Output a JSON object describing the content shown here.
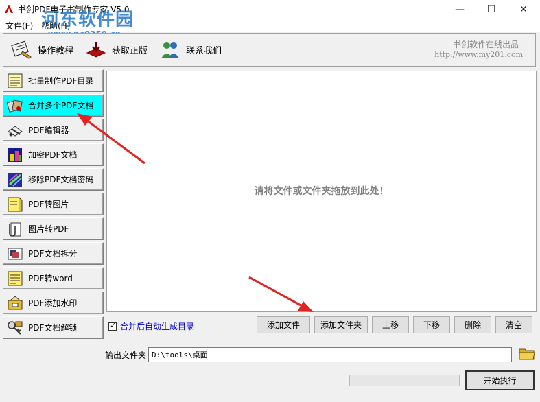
{
  "window": {
    "title": "书剑PDF电子书制作专家 V5.0",
    "minimize_glyph": "—",
    "maximize_glyph": "☐",
    "close_glyph": "✕"
  },
  "watermark": {
    "text": "河东软件园",
    "url": "www.pc0359.cn"
  },
  "menu": {
    "file": "文件(F)",
    "help": "帮助(H)"
  },
  "toolbar": {
    "tutorial": "操作教程",
    "buy": "获取正版",
    "contact": "联系我们",
    "brand": "书剑软件在线出品",
    "brand_url": "http://www.my201.com"
  },
  "sidebar": {
    "items": [
      {
        "label": "批量制作PDF目录",
        "icon": "catalog-icon"
      },
      {
        "label": "合并多个PDF文档",
        "icon": "merge-icon"
      },
      {
        "label": "PDF编辑器",
        "icon": "editor-icon"
      },
      {
        "label": "加密PDF文档",
        "icon": "lock-icon"
      },
      {
        "label": "移除PDF文档密码",
        "icon": "unlock-password-icon"
      },
      {
        "label": "PDF转图片",
        "icon": "image-icon"
      },
      {
        "label": "图片转PDF",
        "icon": "clip-icon"
      },
      {
        "label": "PDF文档拆分",
        "icon": "split-icon"
      },
      {
        "label": "PDF转word",
        "icon": "word-icon"
      },
      {
        "label": "PDF添加水印",
        "icon": "watermark-icon"
      },
      {
        "label": "PDF文档解锁",
        "icon": "key-icon"
      }
    ],
    "active_index": 1
  },
  "main": {
    "drop_hint": "请将文件或文件夹拖放到此处！",
    "auto_toc_label": "合并后自动生成目录",
    "auto_toc_checked": true,
    "buttons": {
      "add_file": "添加文件",
      "add_folder": "添加文件夹",
      "up": "上移",
      "down": "下移",
      "delete": "删除",
      "clear": "清空"
    },
    "output_label": "输出文件夹",
    "output_path": "D:\\tools\\桌面",
    "progress_fraction": 0,
    "start_button": "开始执行"
  },
  "colors": {
    "active_item": "#00ffff",
    "arrow": "#e32222",
    "checkbox_label": "#0000cc",
    "watermark": "#1c73c9"
  }
}
